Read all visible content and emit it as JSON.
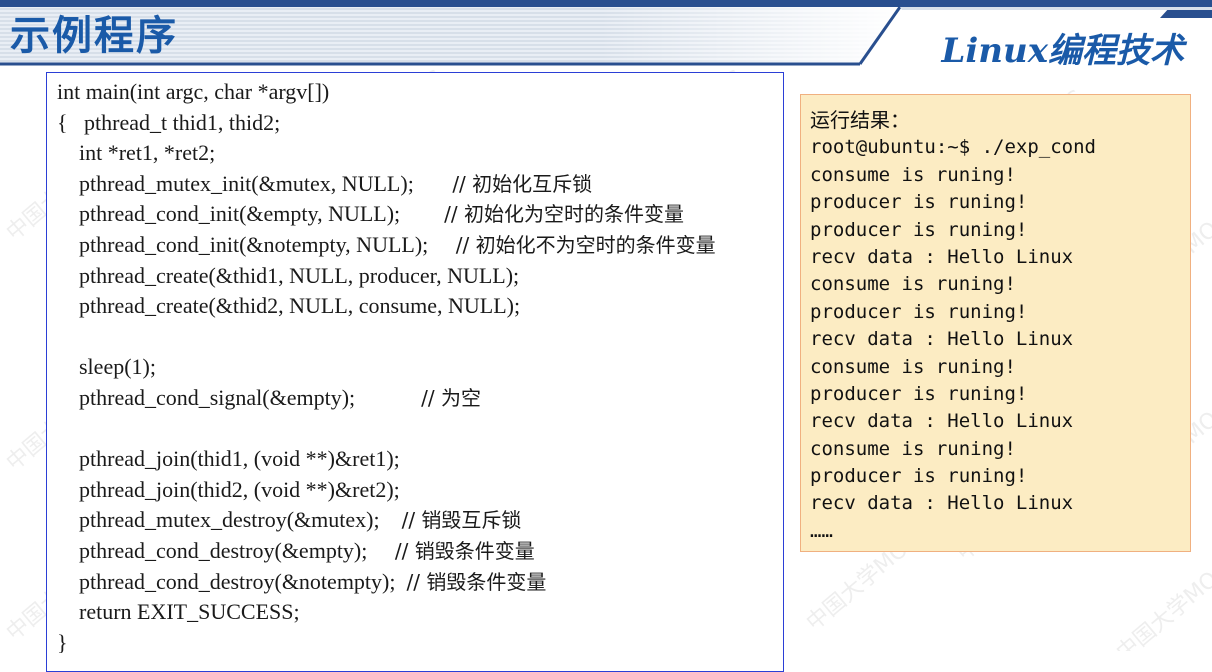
{
  "header": {
    "title": "示例程序",
    "brand": "Linux编程技术",
    "accent_color": "#1a5aa8",
    "bar_color": "#294f8f"
  },
  "watermark": "中国大学MOOC",
  "code": {
    "lines": [
      {
        "code": "int main(int argc, char *argv[])",
        "comment": ""
      },
      {
        "code": "{   pthread_t thid1, thid2;",
        "comment": ""
      },
      {
        "code": "    int *ret1, *ret2;",
        "comment": ""
      },
      {
        "code": "    pthread_mutex_init(&mutex, NULL);       ",
        "comment": "// 初始化互斥锁"
      },
      {
        "code": "    pthread_cond_init(&empty, NULL);        ",
        "comment": "// 初始化为空时的条件变量"
      },
      {
        "code": "    pthread_cond_init(&notempty, NULL);     ",
        "comment": "// 初始化不为空时的条件变量"
      },
      {
        "code": "    pthread_create(&thid1, NULL, producer, NULL);",
        "comment": ""
      },
      {
        "code": "    pthread_create(&thid2, NULL, consume, NULL);",
        "comment": ""
      },
      {
        "code": "",
        "comment": ""
      },
      {
        "code": "    sleep(1);",
        "comment": ""
      },
      {
        "code": "    pthread_cond_signal(&empty);            ",
        "comment": "// 为空"
      },
      {
        "code": "",
        "comment": ""
      },
      {
        "code": "    pthread_join(thid1, (void **)&ret1);",
        "comment": ""
      },
      {
        "code": "    pthread_join(thid2, (void **)&ret2);",
        "comment": ""
      },
      {
        "code": "    pthread_mutex_destroy(&mutex);    ",
        "comment": "// 销毁互斥锁"
      },
      {
        "code": "    pthread_cond_destroy(&empty);     ",
        "comment": "// 销毁条件变量"
      },
      {
        "code": "    pthread_cond_destroy(&notempty);  ",
        "comment": "// 销毁条件变量"
      },
      {
        "code": "    return EXIT_SUCCESS;",
        "comment": ""
      },
      {
        "code": "}",
        "comment": ""
      }
    ]
  },
  "result": {
    "heading": "运行结果：",
    "lines": [
      "root@ubuntu:~$ ./exp_cond",
      "consume is runing!",
      "producer is runing!",
      "producer is runing!",
      "recv data : Hello Linux",
      "consume is runing!",
      "producer is runing!",
      "recv data : Hello Linux",
      "consume is runing!",
      "producer is runing!",
      "recv data : Hello Linux",
      "consume is runing!",
      "producer is runing!",
      "recv data : Hello Linux",
      "……"
    ]
  }
}
